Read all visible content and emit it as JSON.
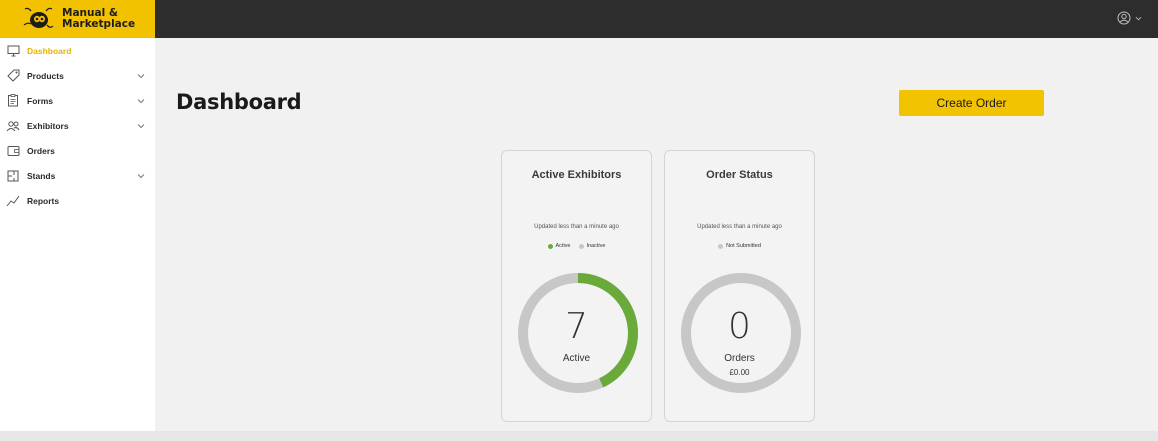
{
  "brand": {
    "line1": "Manual &",
    "line2": "Marketplace",
    "color": "#f2c100"
  },
  "user_menu": {
    "icon": "user-circle-icon",
    "caret": "chevron-down-icon"
  },
  "sidebar": {
    "items": [
      {
        "label": "Dashboard",
        "icon": "monitor-icon",
        "active": true,
        "expandable": false
      },
      {
        "label": "Products",
        "icon": "tag-icon",
        "active": false,
        "expandable": true
      },
      {
        "label": "Forms",
        "icon": "clipboard-icon",
        "active": false,
        "expandable": true
      },
      {
        "label": "Exhibitors",
        "icon": "users-icon",
        "active": false,
        "expandable": true
      },
      {
        "label": "Orders",
        "icon": "wallet-icon",
        "active": false,
        "expandable": false
      },
      {
        "label": "Stands",
        "icon": "floorplan-icon",
        "active": false,
        "expandable": true
      },
      {
        "label": "Reports",
        "icon": "line-chart-icon",
        "active": false,
        "expandable": false
      }
    ]
  },
  "main": {
    "title": "Dashboard",
    "create_order_label": "Create Order"
  },
  "cards": [
    {
      "title": "Active Exhibitors",
      "updated": "Updated less than a minute ago",
      "legend": [
        {
          "label": "Active",
          "color": "#6aaa3a"
        },
        {
          "label": "Inactive",
          "color": "#c7c7c7"
        }
      ],
      "value": "7",
      "value_label": "Active",
      "sub_label": "",
      "fraction_active": 0.43
    },
    {
      "title": "Order Status",
      "updated": "Updated less than a minute ago",
      "legend": [
        {
          "label": "Not Submitted",
          "color": "#c7c7c7"
        }
      ],
      "value": "0",
      "value_label": "Orders",
      "sub_label": "£0.00",
      "fraction_active": 0
    }
  ],
  "colors": {
    "accent": "#f2c300",
    "active_green": "#6aaa3a",
    "inactive_grey": "#c7c7c7",
    "topbar": "#2d2d2d"
  }
}
